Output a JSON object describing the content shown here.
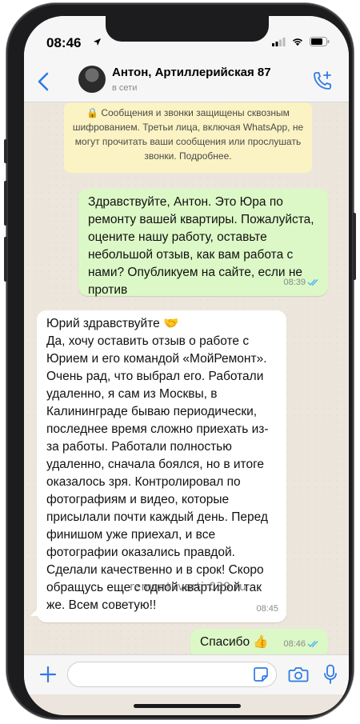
{
  "status_bar": {
    "time": "08:46"
  },
  "header": {
    "contact_name": "Антон, Артиллерийская 87",
    "contact_status": "в сети"
  },
  "system_note": {
    "text": "🔒 Сообщения и звонки защищены сквозным шифрованием. Третьи лица, включая WhatsApp, не могут прочитать ваши сообщения или прослушать звонки. Подробнее."
  },
  "messages": [
    {
      "direction": "outgoing",
      "text": "Здравствуйте, Антон. Это Юра по ремонту вашей квартиры. Пожалуйста, оцените нашу работу, оставьте небольшой отзыв, как вам работа с нами? Опубликуем на сайте, если не против",
      "time": "08:39",
      "read": true
    },
    {
      "direction": "incoming",
      "text": "Юрий здравствуйте 🤝\nДа, хочу оставить отзыв о работе с Юрием и его командой «МойРемонт». Очень рад, что выбрал его. Работали удаленно, я сам из Москвы, в Калининграде бываю периодически, последнее время сложно приехать из-за работы. Работали полностью удаленно, сначала боялся, но в итоге оказалось зря. Контролировал по фотографиям и видео, которые присылали почти каждый день. Перед финишом уже приехал, и все фотографии оказались правдой. Сделали качественно и в срок! Скоро обращусь еще с одной квартирой так же. Всем советую!!",
      "time": "08:45"
    },
    {
      "direction": "outgoing",
      "text": "Спасибо 👍",
      "time": "08:46",
      "read": true
    }
  ],
  "watermark": "remontkvartir039.ru",
  "colors": {
    "outgoing_bubble": "#dcf8c6",
    "incoming_bubble": "#ffffff",
    "accent": "#2f7ae5",
    "read_ticks": "#4fb6ec",
    "system_note_bg": "#fbf3c3"
  }
}
